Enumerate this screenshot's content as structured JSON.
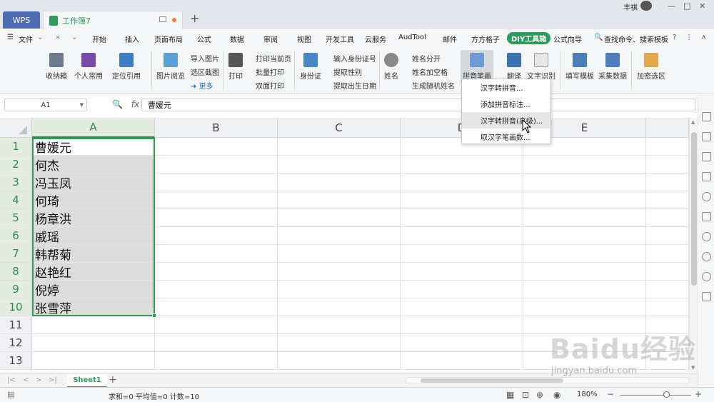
{
  "titlebar": {
    "app_tab": "WPS",
    "doc_tab": "工作簿7",
    "user_name": "丰祺"
  },
  "menubar": {
    "file": "文件",
    "items": [
      "开始",
      "插入",
      "页面布局",
      "公式",
      "数据",
      "审阅",
      "视图",
      "开发工具",
      "云服务",
      "AudTool",
      "邮件",
      "方方格子",
      "DIY工具箱",
      "公式向导"
    ],
    "search": "查找命令、搜索模板"
  },
  "ribbon": {
    "btn_receive": "收纳箱",
    "btn_personal": "个人常用",
    "btn_locate": "定位引用",
    "btn_picview": "图片阅览",
    "import_pic": "导入图片",
    "region_capture": "选区截图",
    "more": "更多",
    "btn_print": "打印",
    "print_current": "打印当前页",
    "batch_print": "批量打印",
    "duplex_print": "双面打印",
    "btn_idcard": "身份证",
    "input_id": "输入身份证号",
    "extract_gender": "提取性别",
    "extract_birth": "提取出生日期",
    "btn_name": "姓名",
    "name_split": "姓名分开",
    "name_space": "姓名加空格",
    "gen_random_name": "生成随机姓名",
    "btn_pinyin": "拼音笔画",
    "btn_translate": "翻译",
    "btn_ocr": "文字识别",
    "btn_fill_template": "填写模板",
    "btn_collect": "采集数据",
    "btn_encrypt": "加密选区"
  },
  "formula_bar": {
    "cell_ref": "A1",
    "fx": "fx",
    "content": "曹媛元"
  },
  "grid": {
    "columns": [
      "A",
      "B",
      "C",
      "D",
      "E"
    ],
    "rows": [
      "1",
      "2",
      "3",
      "4",
      "5",
      "6",
      "7",
      "8",
      "9",
      "10",
      "11",
      "12",
      "13"
    ],
    "col_a_values": [
      "曹媛元",
      "何杰",
      "冯玉凤",
      "何琦",
      "杨章洪",
      "戚瑶",
      "韩帮菊",
      "赵艳红",
      "倪婷",
      "张雪萍"
    ]
  },
  "dropdown": {
    "items": [
      "汉字转拼音...",
      "添加拼音标注...",
      "汉字转拼音(高级)...",
      "取汉字笔画数..."
    ],
    "hovered_index": 2
  },
  "sheets": {
    "active": "Sheet1"
  },
  "status": {
    "summary": "求和=0  平均值=0  计数=10",
    "zoom": "180%"
  },
  "watermark": {
    "main": "Baidu经验",
    "sub": "jingyan.baidu.com"
  },
  "colors": {
    "accent_green": "#2f9b5b",
    "wps_tab": "#4f6cb3"
  }
}
